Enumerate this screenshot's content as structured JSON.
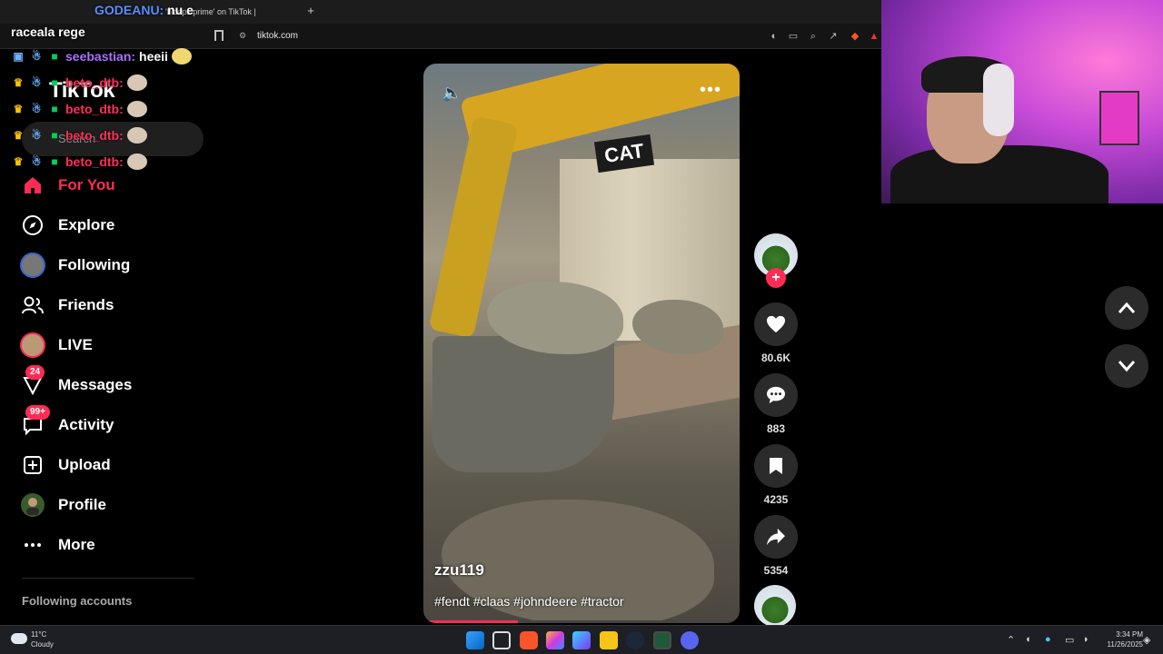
{
  "browser": {
    "tab_title": "'biceps prime' on TikTok |",
    "new_tab": "+",
    "url": "tiktok.com"
  },
  "chat": {
    "channel": "raceala rege",
    "streamer_name": "GODEANU:",
    "streamer_message": "nu e",
    "lines": [
      {
        "user": "seebastian:",
        "text": "heeii"
      },
      {
        "user": "beto_dtb:",
        "text": ""
      },
      {
        "user": "beto_dtb:",
        "text": ""
      },
      {
        "user": "beto_dtb:",
        "text": ""
      },
      {
        "user": "beto_dtb:",
        "text": ""
      }
    ]
  },
  "tiktok": {
    "logo": "TikTok",
    "search_placeholder": "Search",
    "nav": [
      {
        "label": "For You",
        "icon": "home-icon"
      },
      {
        "label": "Explore",
        "icon": "compass-icon"
      },
      {
        "label": "Following",
        "icon": "avatar-icon"
      },
      {
        "label": "Friends",
        "icon": "friends-icon"
      },
      {
        "label": "LIVE",
        "icon": "live-icon"
      },
      {
        "label": "Messages",
        "icon": "messages-icon",
        "badge": "24"
      },
      {
        "label": "Activity",
        "icon": "activity-icon",
        "badge": "99+"
      },
      {
        "label": "Upload",
        "icon": "upload-icon"
      },
      {
        "label": "Profile",
        "icon": "profile-icon"
      },
      {
        "label": "More",
        "icon": "more-icon"
      }
    ],
    "following_accounts_title": "Following accounts",
    "accent": "#fe2c55"
  },
  "video": {
    "author": "zzu119",
    "caption": "#fendt #claas #johndeere #tractor",
    "brand_text": "CAT",
    "progress": 0.3
  },
  "actions": {
    "likes": "80.6K",
    "comments": "883",
    "saves": "4235",
    "shares": "5354"
  },
  "taskbar": {
    "temp": "11°C",
    "weather": "Cloudy",
    "time": "3:34 PM",
    "date": "11/26/2025"
  }
}
